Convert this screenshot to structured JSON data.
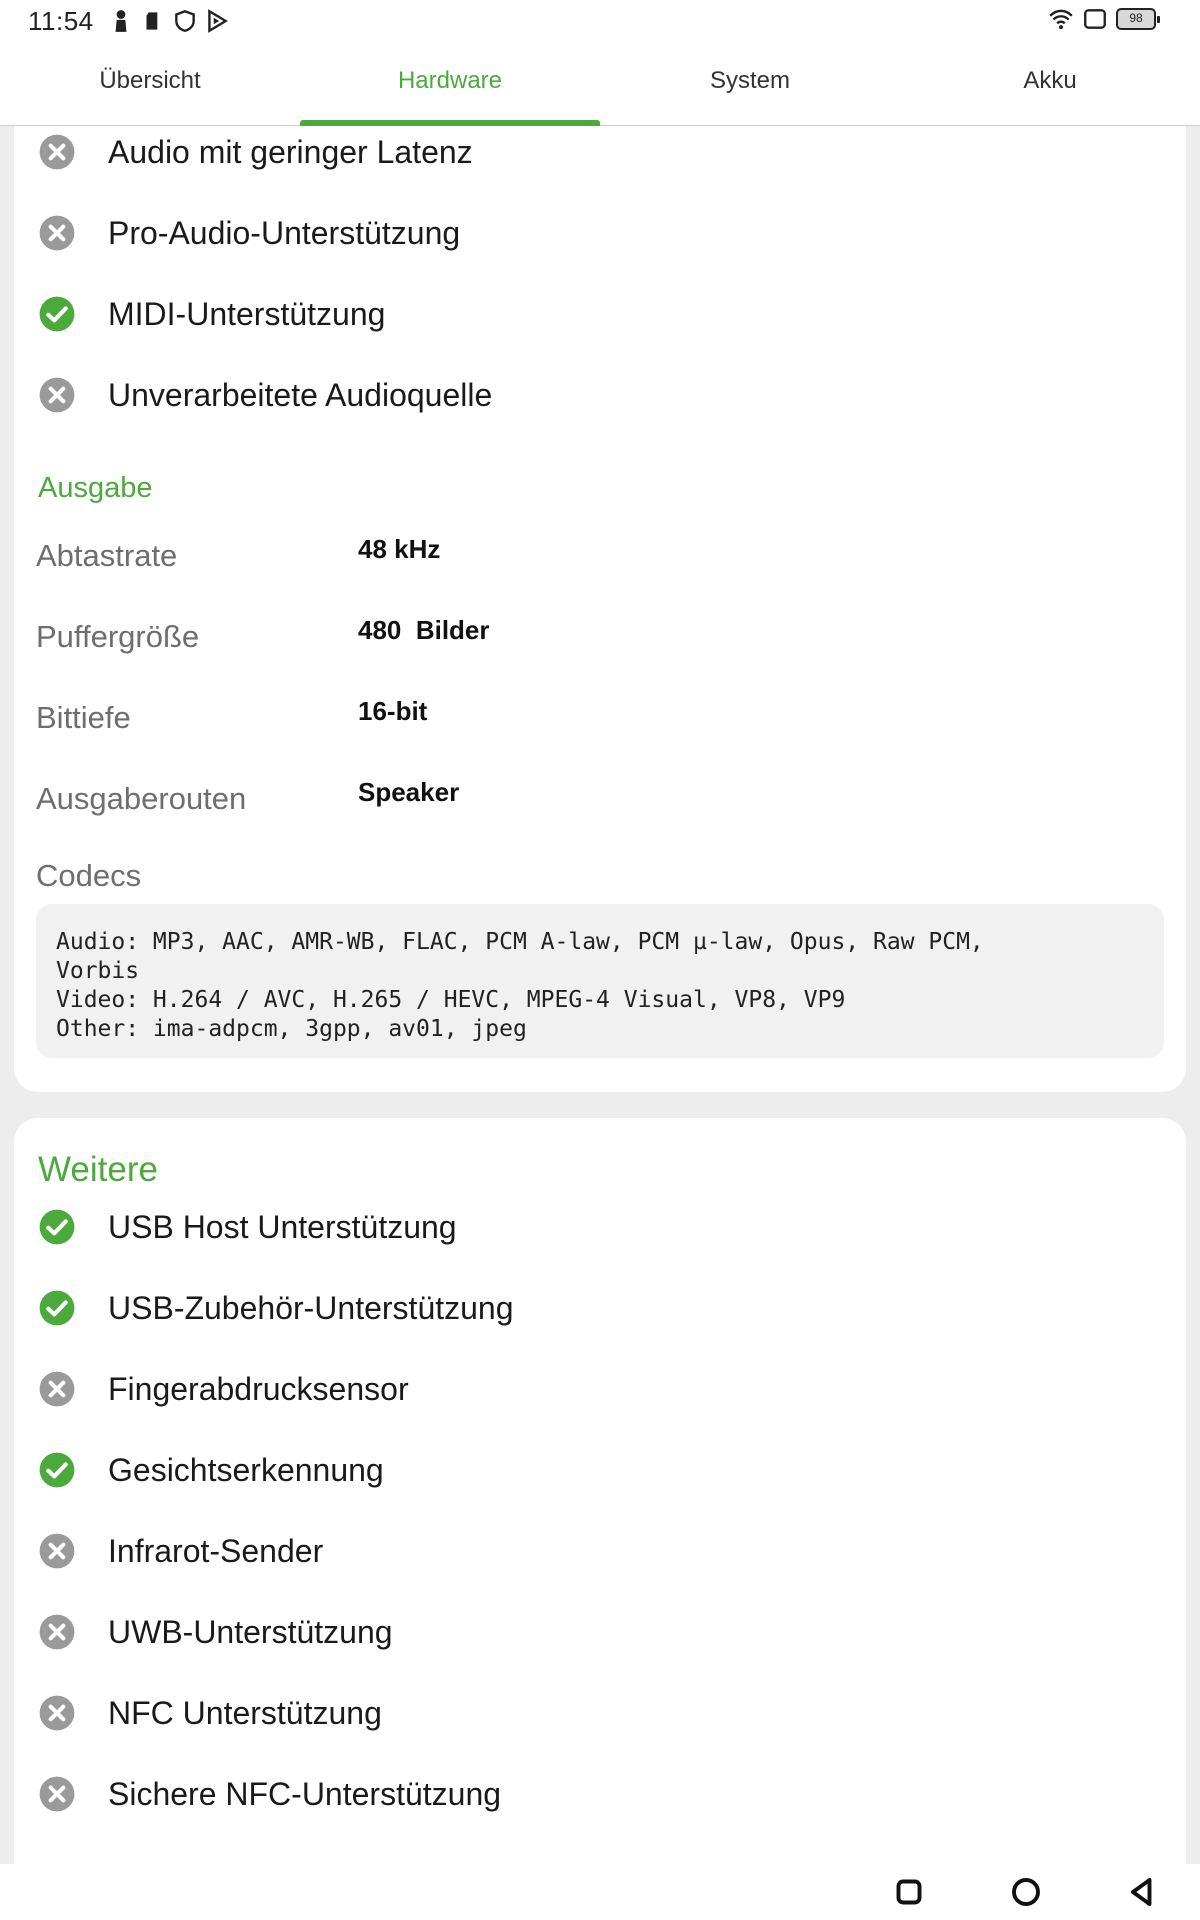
{
  "status_bar": {
    "time": "11:54",
    "battery_level": "98",
    "left_icons": [
      "person-icon",
      "sd-card-icon",
      "shield-icon",
      "play-protect-icon"
    ],
    "right_icons": [
      "wifi-icon",
      "screen-icon",
      "battery-icon"
    ]
  },
  "tabs": [
    {
      "label": "Übersicht",
      "active": false
    },
    {
      "label": "Hardware",
      "active": true
    },
    {
      "label": "System",
      "active": false
    },
    {
      "label": "Akku",
      "active": false
    }
  ],
  "audio_features": [
    {
      "label": "Audio mit geringer Latenz",
      "supported": false
    },
    {
      "label": "Pro-Audio-Unterstützung",
      "supported": false
    },
    {
      "label": "MIDI-Unterstützung",
      "supported": true
    },
    {
      "label": "Unverarbeitete Audioquelle",
      "supported": false
    }
  ],
  "output": {
    "title": "Ausgabe",
    "rows": [
      {
        "key": "Abtastrate",
        "value": "48 kHz"
      },
      {
        "key": "Puffergröße",
        "value": "480  Bilder"
      },
      {
        "key": "Bittiefe",
        "value": "16-bit"
      },
      {
        "key": "Ausgaberouten",
        "value": "Speaker"
      }
    ],
    "codecs_label": "Codecs",
    "codecs_lines": [
      "Audio: MP3, AAC, AMR-WB, FLAC, PCM A-law, PCM µ-law, Opus, Raw PCM,",
      "Vorbis",
      "Video: H.264 / AVC, H.265 / HEVC, MPEG-4 Visual, VP8, VP9",
      "Other: ima-adpcm, 3gpp, av01, jpeg"
    ]
  },
  "further": {
    "title": "Weitere",
    "features": [
      {
        "label": "USB Host Unterstützung",
        "supported": true
      },
      {
        "label": "USB-Zubehör-Unterstützung",
        "supported": true
      },
      {
        "label": "Fingerabdrucksensor",
        "supported": false
      },
      {
        "label": "Gesichtserkennung",
        "supported": true
      },
      {
        "label": "Infrarot-Sender",
        "supported": false
      },
      {
        "label": "UWB-Unterstützung",
        "supported": false
      },
      {
        "label": "NFC Unterstützung",
        "supported": false
      },
      {
        "label": "Sichere NFC-Unterstützung",
        "supported": false
      }
    ]
  },
  "colors": {
    "accent": "#4caa3c",
    "unsupported_icon": "#9a9a9a",
    "background": "#ededed",
    "card": "#ffffff"
  },
  "nav_bar": [
    "recents-button",
    "home-button",
    "back-button"
  ]
}
